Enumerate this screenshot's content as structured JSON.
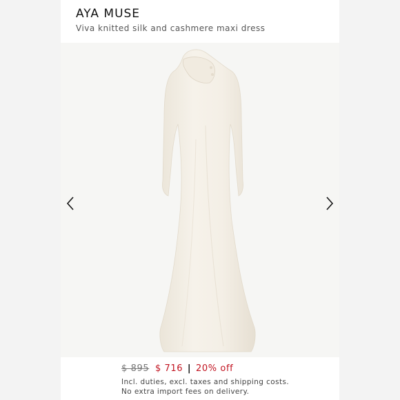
{
  "product": {
    "brand": "AYA MUSE",
    "title": "Viva knitted silk and cashmere maxi dress"
  },
  "gallery": {
    "image_alt": "dress-image",
    "dress_color": "#f3eee4",
    "prev_icon": "chevron-left-icon",
    "next_icon": "chevron-right-icon"
  },
  "pricing": {
    "original": "$ 895",
    "sale": "$ 716",
    "separator": "|",
    "discount": "20% off",
    "note_line1": "Incl. duties, excl. taxes and shipping costs.",
    "note_line2": "No extra import fees on delivery.",
    "sale_color": "#c1121f"
  }
}
